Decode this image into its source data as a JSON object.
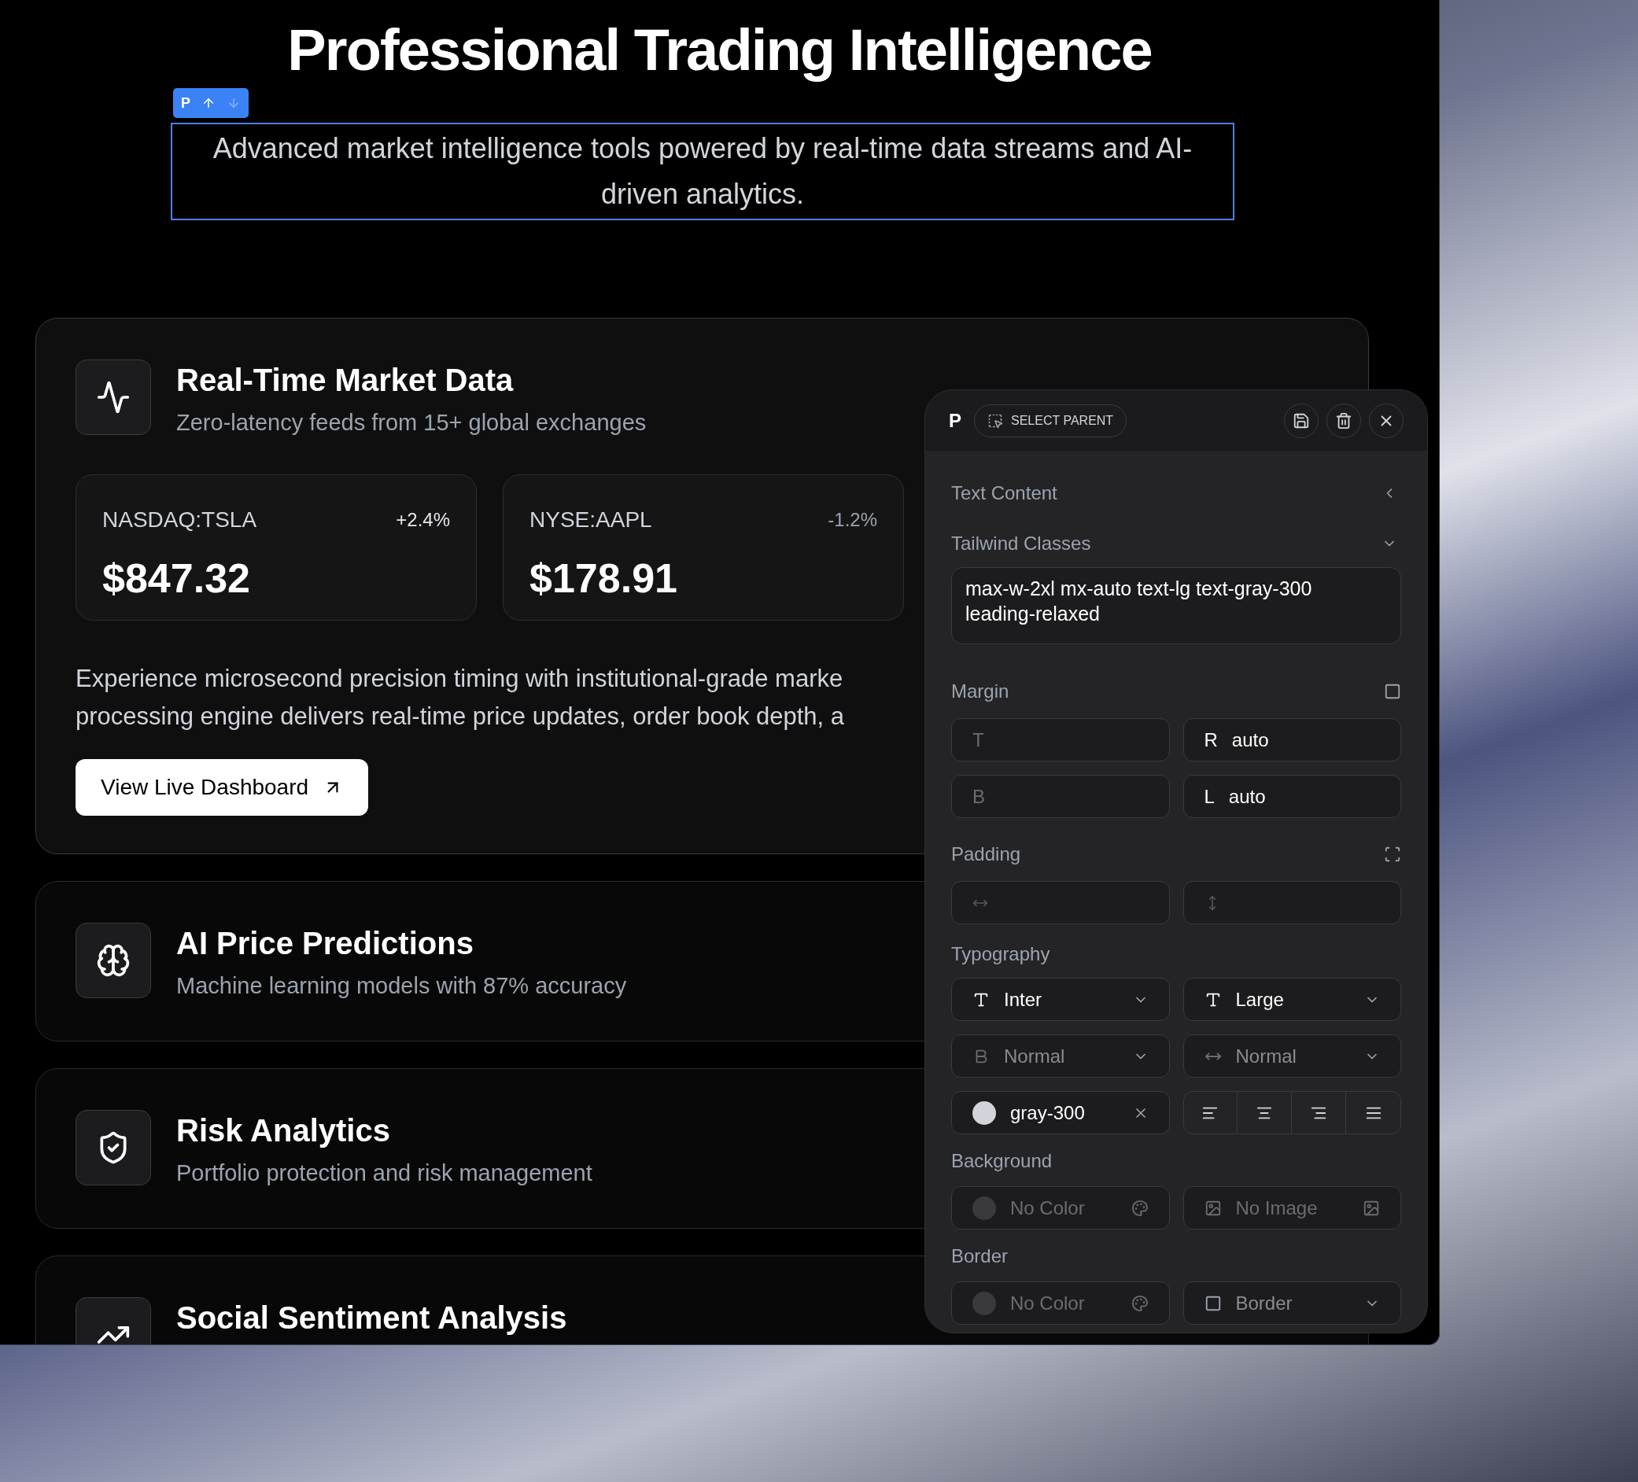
{
  "page": {
    "title": "Professional Trading Intelligence",
    "element_toolbar": {
      "tag": "P",
      "move_up": {
        "disabled": false
      },
      "move_down": {
        "disabled": true
      }
    },
    "selected_paragraph": {
      "text": "Advanced market intelligence tools powered by real-time data streams and AI-driven analytics.",
      "selected": true
    },
    "features": [
      {
        "kind": "pulse",
        "title": "Real-Time Market Data",
        "subtitle": "Zero-latency feeds from 15+ global exchanges",
        "expanded": true,
        "tickers": [
          {
            "symbol": "NASDAQ:TSLA",
            "change": "+2.4%",
            "up": true,
            "price": "$847.32"
          },
          {
            "symbol": "NYSE:AAPL",
            "change": "-1.2%",
            "up": false,
            "price": "$178.91"
          }
        ],
        "description_lines": [
          "Experience microsecond precision timing with institutional-grade marke",
          "processing engine delivers real-time price updates, order book depth, a"
        ],
        "button": "View Live Dashboard"
      },
      {
        "kind": "brain",
        "title": "AI Price Predictions",
        "subtitle": "Machine learning models with 87% accuracy",
        "expanded": false
      },
      {
        "kind": "shield",
        "title": "Risk Analytics",
        "subtitle": "Portfolio protection and risk management",
        "expanded": false
      },
      {
        "kind": "trend",
        "title": "Social Sentiment Analysis",
        "expanded": false
      }
    ]
  },
  "inspector": {
    "tag": "P",
    "select_parent": "SELECT PARENT",
    "text_content": {
      "label": "Text Content",
      "expanded": false
    },
    "tailwind_classes": {
      "label": "Tailwind Classes",
      "expanded": true,
      "value": "max-w-2xl mx-auto text-lg text-gray-300 leading-relaxed"
    },
    "margin": {
      "label": "Margin",
      "fields": [
        {
          "label": "T"
        },
        {
          "label": "R",
          "value": "auto"
        },
        {
          "label": "B"
        },
        {
          "label": "L",
          "value": "auto"
        }
      ]
    },
    "padding": {
      "label": "Padding",
      "fields": [
        {
          "kind": "horizontal"
        },
        {
          "kind": "vertical"
        }
      ]
    },
    "typography": {
      "label": "Typography",
      "selects": [
        {
          "kind": "font",
          "value": "Inter",
          "set": true
        },
        {
          "kind": "size",
          "value": "Large",
          "set": true
        },
        {
          "kind": "weight",
          "value": "Normal",
          "set": false
        },
        {
          "kind": "spacing",
          "value": "Normal",
          "set": false
        }
      ],
      "color": {
        "value": "gray-300",
        "color": "#d1d5db"
      },
      "align": [
        {
          "kind": "left",
          "selected": false
        },
        {
          "kind": "center",
          "selected": false
        },
        {
          "kind": "right",
          "selected": false
        },
        {
          "kind": "justify",
          "selected": false
        }
      ]
    },
    "background": {
      "label": "Background",
      "color_label": "No Color",
      "image_label": "No Image"
    },
    "border": {
      "label": "Border",
      "color_label": "No Color",
      "style_label": "Border"
    }
  }
}
